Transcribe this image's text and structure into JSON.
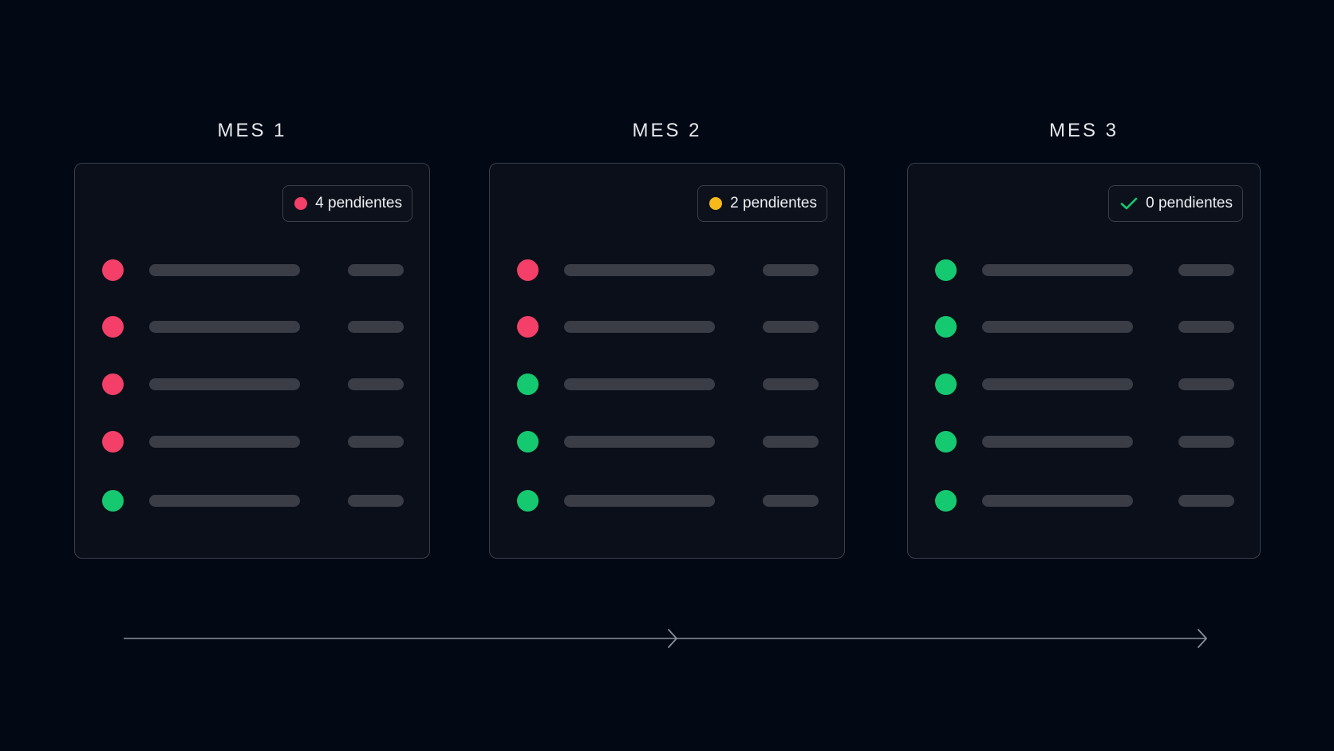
{
  "colors": {
    "background": "#030815",
    "pending": "#f43f68",
    "warning": "#f5b91a",
    "done": "#15c970",
    "placeholder": "#3a3d46",
    "border": "#3a3f4a"
  },
  "months": [
    {
      "title": "MES 1",
      "badge": {
        "text": "4 pendientes",
        "icon": "red-dot-icon",
        "color": "#f43f68"
      },
      "rows": [
        "pending",
        "pending",
        "pending",
        "pending",
        "done"
      ]
    },
    {
      "title": "MES 2",
      "badge": {
        "text": "2 pendientes",
        "icon": "yellow-dot-icon",
        "color": "#f5b91a"
      },
      "rows": [
        "pending",
        "pending",
        "done",
        "done",
        "done"
      ]
    },
    {
      "title": "MES 3",
      "badge": {
        "text": "0 pendientes",
        "icon": "check-icon",
        "color": "#15c970"
      },
      "rows": [
        "done",
        "done",
        "done",
        "done",
        "done"
      ]
    }
  ]
}
